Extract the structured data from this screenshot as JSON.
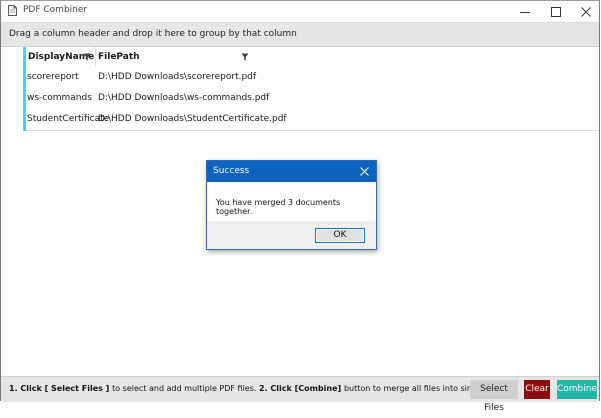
{
  "window": {
    "title": "PDF Combiner"
  },
  "group_panel": {
    "hint": "Drag a column header and drop it here to group by that column"
  },
  "grid": {
    "columns": [
      {
        "label": "DisplayName"
      },
      {
        "label": "FilePath"
      }
    ],
    "rows": [
      {
        "name": "scorereport",
        "path": "D:\\HDD Downloads\\scorereport.pdf"
      },
      {
        "name": "ws-commands",
        "path": "D:\\HDD Downloads\\ws-commands.pdf"
      },
      {
        "name": "StudentCertificate",
        "path": "D:\\HDD Downloads\\StudentCertificate.pdf"
      }
    ]
  },
  "dialog": {
    "title": "Success",
    "message": "You have merged 3 documents together.",
    "ok_label": "OK"
  },
  "footer": {
    "step1_prefix": "1. Click ",
    "step1_button": " [ Select Files ] ",
    "step1_suffix": " to select and add multiple PDF files.  ",
    "step2_prefix": "2. Click ",
    "step2_button": " [Combine] ",
    "step2_suffix": " button to merge all files into single PDF.",
    "select_label": "Select Files",
    "clear_label": "Clear",
    "combine_label": "Combine"
  },
  "colors": {
    "accent_stripe": "#5bc8e5",
    "dialog_title": "#0c64c0",
    "clear_button": "#8b0c0c",
    "combine_button": "#22b5a4"
  },
  "icons": {
    "app": "document-icon",
    "minimize": "minimize-icon",
    "maximize": "maximize-icon",
    "close": "close-icon",
    "filter": "filter-icon"
  }
}
